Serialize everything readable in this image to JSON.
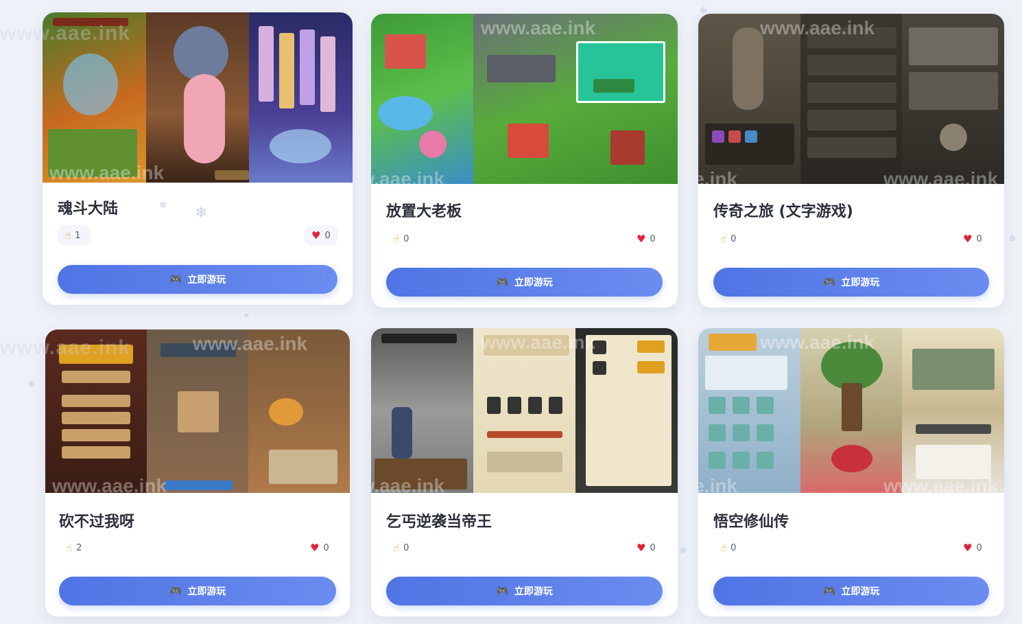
{
  "watermark": "www.aae.ink",
  "play_label": "立即游玩",
  "icons": {
    "click": "pointing-hand-icon",
    "like": "heart-icon",
    "play": "gamepad-icon"
  },
  "games": [
    {
      "title": "魂斗大陆",
      "clicks": "1",
      "likes": "0"
    },
    {
      "title": "放置大老板",
      "clicks": "0",
      "likes": "0"
    },
    {
      "title": "传奇之旅 (文字游戏)",
      "clicks": "0",
      "likes": "0"
    },
    {
      "title": "砍不过我呀",
      "clicks": "2",
      "likes": "0"
    },
    {
      "title": "乞丐逆袭当帝王",
      "clicks": "0",
      "likes": "0"
    },
    {
      "title": "悟空修仙传",
      "clicks": "0",
      "likes": "0"
    }
  ],
  "colors": {
    "accent": "#4f74e4",
    "heart": "#e0233b",
    "background": "#eef1f7"
  }
}
